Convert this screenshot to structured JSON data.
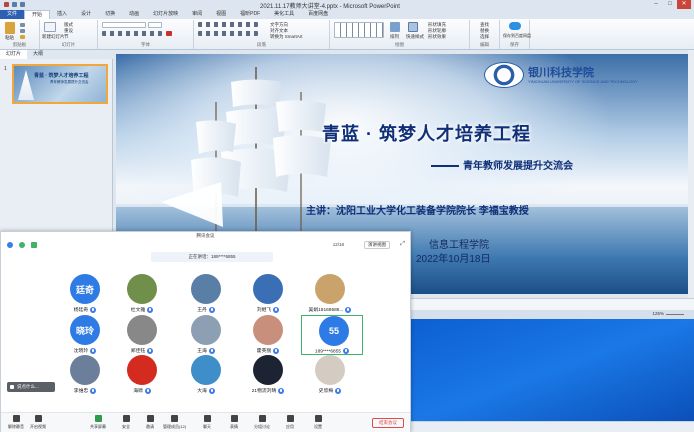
{
  "ppt": {
    "window_title": "2021.11.17教师大讲堂-4.pptx - Microsoft PowerPoint",
    "tabs": [
      "文件",
      "开始",
      "插入",
      "设计",
      "切换",
      "动画",
      "幻灯片放映",
      "审阅",
      "视图",
      "福昕PDF",
      "美化工具",
      "百度网盘"
    ],
    "active_tab": "开始",
    "ribbon_groups": [
      "剪贴板",
      "幻灯片",
      "字体",
      "段落",
      "绘图",
      "编辑",
      "保存"
    ],
    "ribbon_buttons": {
      "paste": "粘贴",
      "new_slide": "新建幻灯片",
      "layout": "版式",
      "reset": "重设",
      "section": "节",
      "text_direction": "文字方向",
      "align_text": "对齐文本",
      "smartart": "转换为 SmartArt",
      "arrange": "排列",
      "quick_styles": "快速样式",
      "shape_fill": "形状填充",
      "shape_outline": "形状轮廓",
      "shape_effects": "形状效果",
      "find": "查找",
      "replace": "替换",
      "select": "选择",
      "save_to_netdisk": "保存到百度网盘"
    },
    "pane_tabs": [
      "幻灯片",
      "大纲"
    ],
    "thumb_number": "1",
    "status_zoom": "125%"
  },
  "slide": {
    "logo_text": "银川科技学院",
    "logo_sub": "YINCHUAN UNIVERSITY OF SCIENCE AND TECHNOLOGY",
    "title": "青蓝 · 筑梦人才培养工程",
    "subtitle": "青年教师发展提升交流会",
    "speaker": "主讲：沈阳工业大学化工装备学院院长   李福宝教授",
    "dept": "信息工程学院",
    "date": "2022年10月18日"
  },
  "meeting": {
    "window_title": "腾讯会议",
    "participant_count": "12/18",
    "layout_label": "演讲视图",
    "speaking_label": "正在讲话：189****6855",
    "participants": [
      {
        "name": "杨廷奇",
        "avatar_text": "廷奇",
        "color": "#2f7be6"
      },
      {
        "name": "杜文雅",
        "avatar_text": "",
        "color": "#6f8f4a"
      },
      {
        "name": "王丹",
        "avatar_text": "",
        "color": "#5a7fa6"
      },
      {
        "name": "刘继飞",
        "avatar_text": "",
        "color": "#3a6fb5"
      },
      {
        "name": "吴娟18169586...",
        "avatar_text": "",
        "color": "#c9a36b"
      },
      {
        "name": "沈晓玲",
        "avatar_text": "晓玲",
        "color": "#2f7be6"
      },
      {
        "name": "郑佳钰",
        "avatar_text": "",
        "color": "#888888"
      },
      {
        "name": "王海",
        "avatar_text": "",
        "color": "#8c9fb3"
      },
      {
        "name": "霍英丽",
        "avatar_text": "",
        "color": "#c88f7c"
      },
      {
        "name": "189****6855",
        "avatar_text": "55",
        "color": "#2f7be6"
      },
      {
        "name": "李维忠",
        "avatar_text": "",
        "color": "#6b7f9a"
      },
      {
        "name": "海啸",
        "avatar_text": "",
        "color": "#d32b1f"
      },
      {
        "name": "大海",
        "avatar_text": "",
        "color": "#3d8ec9"
      },
      {
        "name": "21物流刘晴",
        "avatar_text": "",
        "color": "#1c2333"
      },
      {
        "name": "史欣梅",
        "avatar_text": "",
        "color": "#d4cbc2"
      }
    ],
    "chat_placeholder": "说点什么...",
    "toolbar": [
      {
        "label": "解除静音",
        "icon": "mic-icon",
        "color": "#444444"
      },
      {
        "label": "开启视频",
        "icon": "camera-icon",
        "color": "#444444"
      },
      {
        "label": "共享屏幕",
        "icon": "screen-share-icon",
        "color": "#2e9b4f"
      },
      {
        "label": "安全",
        "icon": "shield-icon",
        "color": "#444444"
      },
      {
        "label": "邀请",
        "icon": "invite-icon",
        "color": "#444444"
      },
      {
        "label": "管理成员(12)",
        "icon": "members-icon",
        "color": "#444444"
      },
      {
        "label": "聊天",
        "icon": "chat-icon",
        "color": "#444444"
      },
      {
        "label": "表情",
        "icon": "emoji-icon",
        "color": "#444444"
      },
      {
        "label": "分组讨论",
        "icon": "breakout-icon",
        "color": "#444444"
      },
      {
        "label": "应用",
        "icon": "apps-icon",
        "color": "#444444"
      },
      {
        "label": "设置",
        "icon": "gear-icon",
        "color": "#444444"
      }
    ],
    "leave_label": "结束会议"
  }
}
